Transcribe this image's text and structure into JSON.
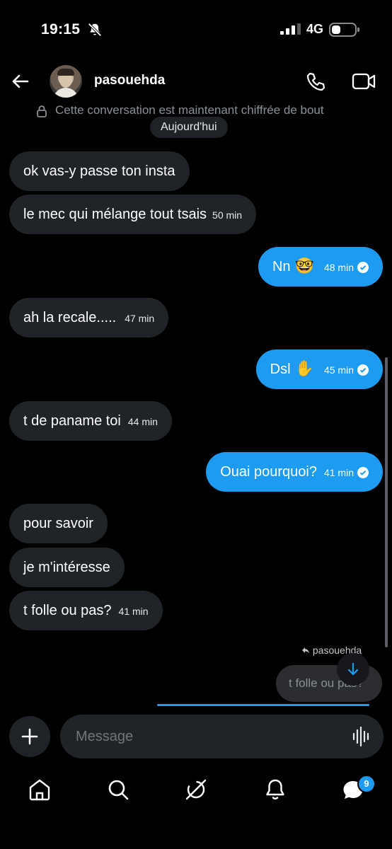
{
  "status_bar": {
    "time": "19:15",
    "network": "4G"
  },
  "header": {
    "username": "pasouehda",
    "encryption_notice": "Cette conversation est maintenant chiffrée de bout"
  },
  "date_separator": "Aujourd'hui",
  "messages": [
    {
      "dir": "in",
      "text": "ok vas-y passe ton insta",
      "time": ""
    },
    {
      "dir": "in",
      "text": "le mec qui mélange tout tsais",
      "time": "50 min"
    },
    {
      "dir": "out",
      "text": "Nn",
      "emoji": "🤓",
      "time": "48 min"
    },
    {
      "dir": "in",
      "text": "ah la recale.....",
      "time": "47 min"
    },
    {
      "dir": "out",
      "text": "Dsl",
      "emoji": "✋",
      "time": "45 min"
    },
    {
      "dir": "in",
      "text": "t de paname toi",
      "time": "44 min"
    },
    {
      "dir": "out",
      "text": "Ouai pourquoi?",
      "time": "41 min"
    },
    {
      "dir": "in",
      "text": "pour savoir",
      "time": ""
    },
    {
      "dir": "in",
      "text": "je m'intéresse",
      "time": ""
    },
    {
      "dir": "in",
      "text": "t folle ou pas?",
      "time": "41 min"
    }
  ],
  "reply_preview": {
    "label": "pasouehda",
    "quote": "t folle ou pas?"
  },
  "composer": {
    "placeholder": "Message"
  },
  "tab_bar": {
    "messages_badge": "9"
  },
  "colors": {
    "accent": "#1d9bf0",
    "incoming_bubble": "#202327",
    "background": "#000000"
  }
}
